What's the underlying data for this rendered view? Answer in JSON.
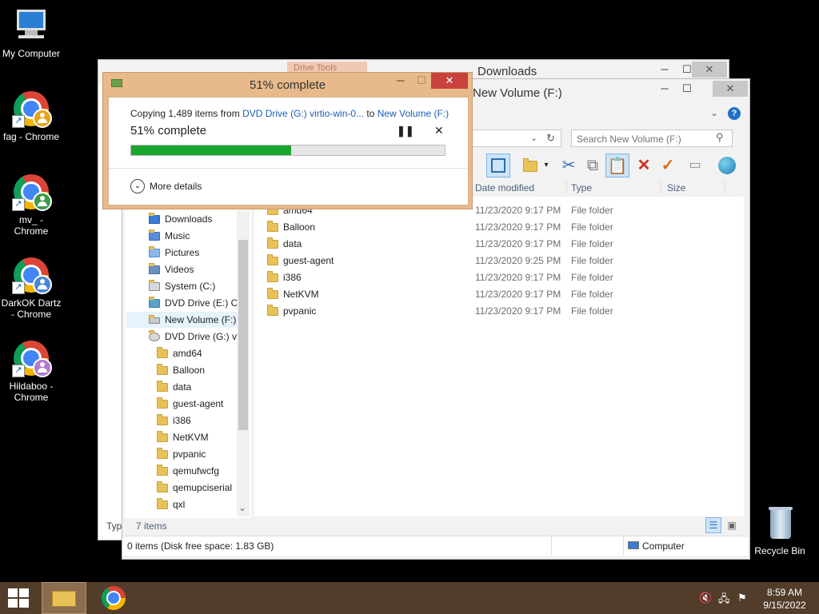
{
  "desktop": {
    "icons": [
      {
        "label": "My Computer"
      },
      {
        "label": "fag - Chrome"
      },
      {
        "label": "mv_ - Chrome"
      },
      {
        "label": "DarkOK Dartz - Chrome"
      },
      {
        "label": "Hildaboo - Chrome"
      }
    ],
    "recycle_bin": {
      "label": "Recycle Bin"
    }
  },
  "back_window": {
    "title": "Downloads",
    "tab_hint": "Drive Tools",
    "status_prefix": "Typ"
  },
  "explorer": {
    "title": "New Volume (F:)",
    "search_placeholder": "Search New Volume (F:)",
    "columns": {
      "date": "Date modified",
      "type": "Type",
      "size": "Size"
    },
    "tree": [
      {
        "label": "Downloads"
      },
      {
        "label": "Music"
      },
      {
        "label": "Pictures"
      },
      {
        "label": "Videos"
      },
      {
        "label": "System (C:)"
      },
      {
        "label": "DVD Drive (E:) CC"
      },
      {
        "label": "New Volume (F:)"
      },
      {
        "label": "DVD Drive (G:) vi"
      },
      {
        "label": "amd64"
      },
      {
        "label": "Balloon"
      },
      {
        "label": "data"
      },
      {
        "label": "guest-agent"
      },
      {
        "label": "i386"
      },
      {
        "label": "NetKVM"
      },
      {
        "label": "pvpanic"
      },
      {
        "label": "qemufwcfg"
      },
      {
        "label": "qemupciserial"
      },
      {
        "label": "qxl"
      }
    ],
    "files": [
      {
        "name": "amd64",
        "date": "11/23/2020 9:17 PM",
        "type": "File folder"
      },
      {
        "name": "Balloon",
        "date": "11/23/2020 9:17 PM",
        "type": "File folder"
      },
      {
        "name": "data",
        "date": "11/23/2020 9:17 PM",
        "type": "File folder"
      },
      {
        "name": "guest-agent",
        "date": "11/23/2020 9:25 PM",
        "type": "File folder"
      },
      {
        "name": "i386",
        "date": "11/23/2020 9:17 PM",
        "type": "File folder"
      },
      {
        "name": "NetKVM",
        "date": "11/23/2020 9:17 PM",
        "type": "File folder"
      },
      {
        "name": "pvpanic",
        "date": "11/23/2020 9:17 PM",
        "type": "File folder"
      }
    ],
    "item_count": "7 items",
    "status_left": "0 items (Disk free space: 1.83 GB)",
    "status_right": "Computer"
  },
  "copy_dialog": {
    "title": "51% complete",
    "line_prefix": "Copying 1,489 items from ",
    "source": "DVD Drive (G:) virtio-win-0...",
    "to_word": " to ",
    "destination": "New Volume (F:)",
    "progress_text": "51% complete",
    "progress": 0.51,
    "progress_color": "#1aa52e",
    "more_details": "More details"
  },
  "taskbar": {
    "time": "8:59 AM",
    "date": "9/15/2022"
  },
  "icons": [
    "start-icon",
    "file-explorer-icon",
    "chrome-icon",
    "volume-muted-icon",
    "network-icon",
    "action-center-icon",
    "pause-icon",
    "close-icon",
    "chevron-down-icon",
    "help-icon",
    "refresh-icon",
    "search-icon"
  ]
}
